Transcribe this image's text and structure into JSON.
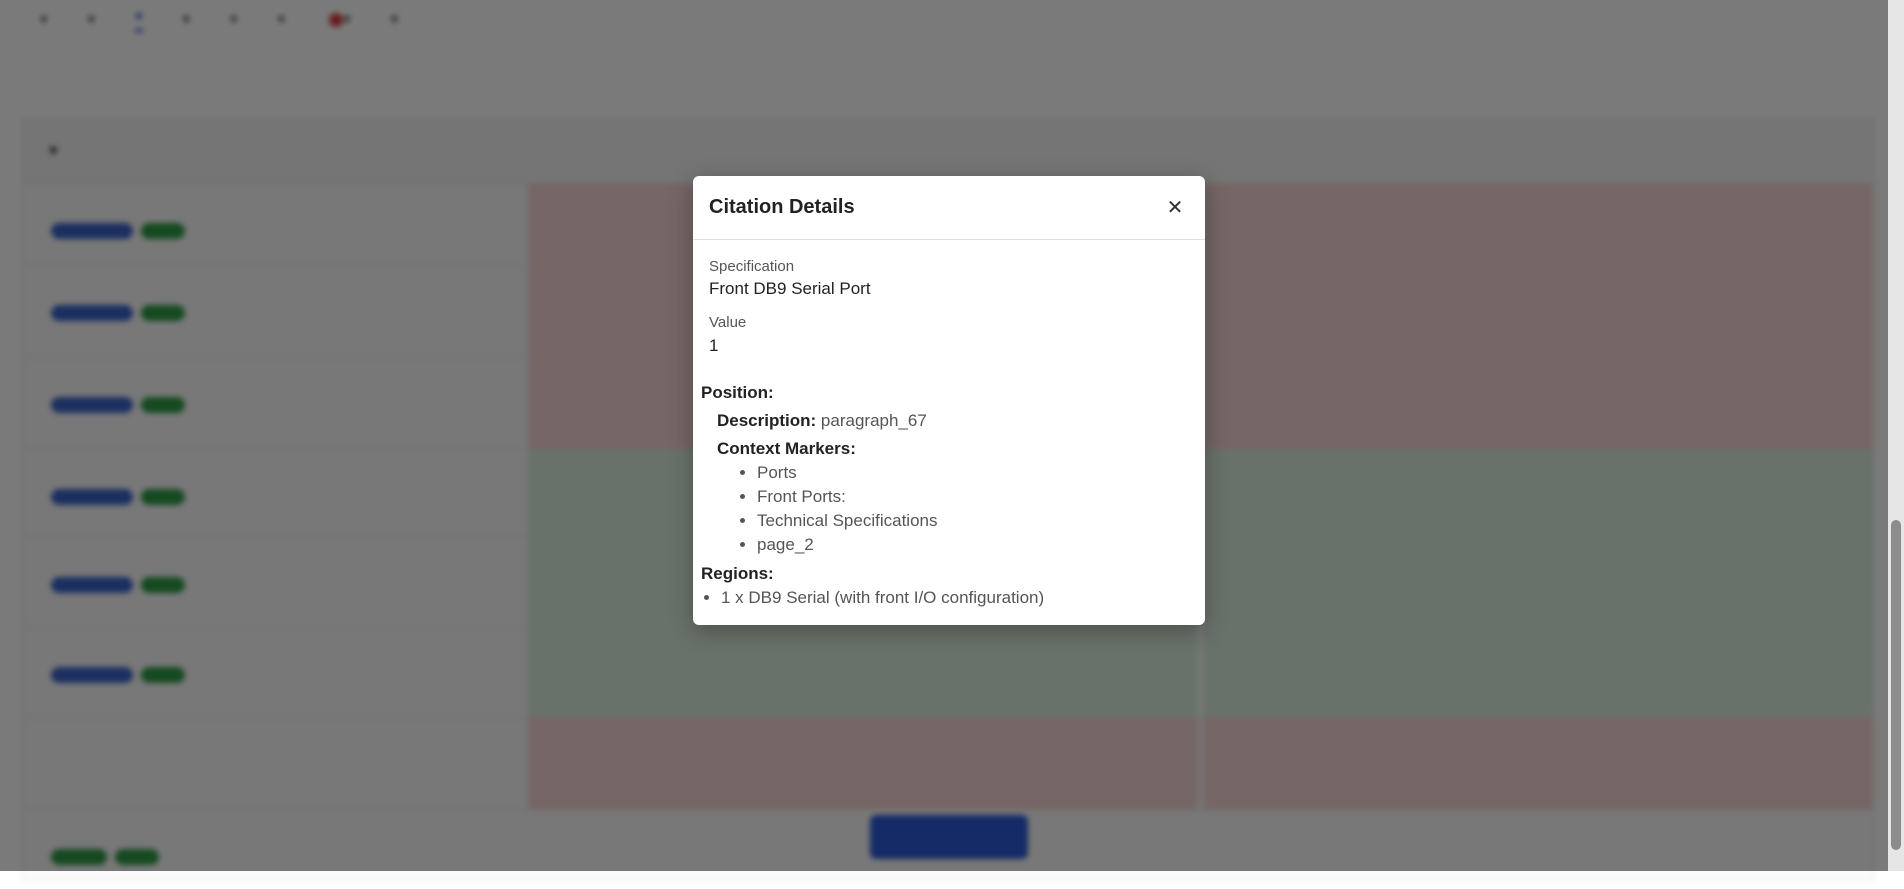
{
  "modal": {
    "title": "Citation Details",
    "close_icon": "close-icon",
    "specification_label": "Specification",
    "specification_value": "Front DB9 Serial Port",
    "value_label": "Value",
    "value_value": "1",
    "position_heading": "Position:",
    "description_label": "Description:",
    "description_value": "paragraph_67",
    "context_markers_heading": "Context Markers:",
    "context_markers": [
      "Ports",
      "Front Ports:",
      "Technical Specifications",
      "page_2"
    ],
    "regions_heading": "Regions:",
    "regions": [
      "1 x DB9 Serial (with front I/O configuration)"
    ]
  },
  "colors": {
    "overlay": "#000000",
    "accent": "#2a5bd7",
    "tag_blue": "#3a64c8",
    "tag_green": "#2e9b46",
    "row_red": "#f6d6d6",
    "row_green": "#dbeedd"
  }
}
